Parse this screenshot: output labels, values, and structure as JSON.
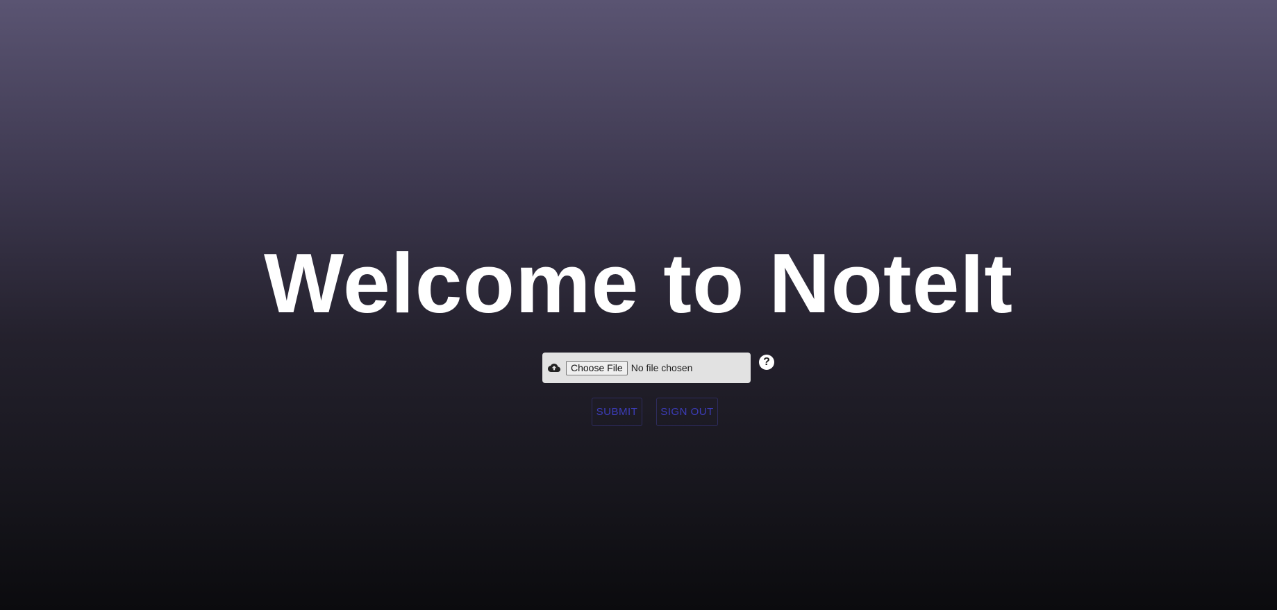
{
  "header": {
    "title": "Welcome to NoteIt"
  },
  "upload": {
    "icon": "cloud-upload-icon",
    "choose_label": "Choose File",
    "status_text": "No file chosen"
  },
  "help": {
    "icon": "help-icon",
    "glyph": "?"
  },
  "actions": {
    "submit_label": "SUBMIT",
    "signout_label": "SIGN OUT"
  },
  "colors": {
    "title": "#ffffff",
    "button_text": "#3d3dbb",
    "button_border": "#2e2c5e",
    "upload_bg": "#e2e2e2",
    "background_top": "#5a5472",
    "background_bottom": "#0b0b0e"
  }
}
